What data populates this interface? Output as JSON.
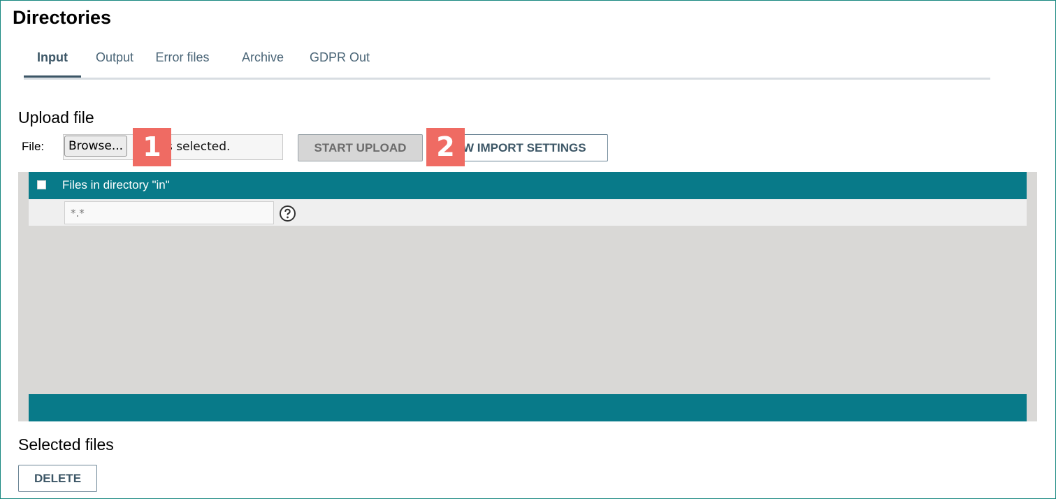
{
  "page": {
    "title": "Directories"
  },
  "tabs": [
    {
      "label": "Input",
      "active": true
    },
    {
      "label": "Output",
      "active": false
    },
    {
      "label": "Error files",
      "active": false
    },
    {
      "label": "Archive",
      "active": false
    },
    {
      "label": "GDPR Out",
      "active": false
    }
  ],
  "upload": {
    "heading": "Upload file",
    "file_label": "File:",
    "browse_label": "Browse...",
    "file_status": "s selected.",
    "start_upload_label": "START UPLOAD",
    "import_settings_label": "W IMPORT SETTINGS"
  },
  "badges": {
    "first": "1",
    "second": "2",
    "color": "#ef6b63"
  },
  "grid": {
    "title": "Files in directory \"in\"",
    "filter_placeholder": "*.*",
    "help_icon": "question-circle-icon",
    "header_color": "#087a89"
  },
  "selected": {
    "heading": "Selected files",
    "delete_label": "DELETE"
  }
}
